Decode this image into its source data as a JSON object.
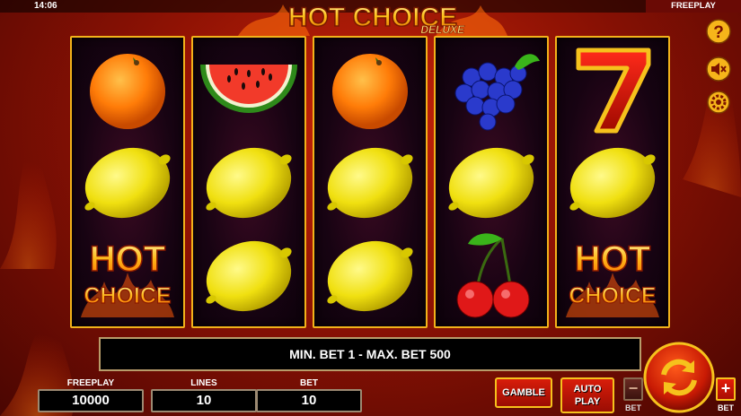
{
  "status_bar": {
    "time": "14:06",
    "mode": "FREEPLAY"
  },
  "game": {
    "title_main": "HOT CHOICE",
    "title_sub": "DELUXE"
  },
  "reels": [
    {
      "symbols": [
        "orange",
        "lemon",
        "hot-choice"
      ]
    },
    {
      "symbols": [
        "watermelon",
        "lemon",
        "lemon"
      ]
    },
    {
      "symbols": [
        "orange",
        "lemon",
        "lemon"
      ]
    },
    {
      "symbols": [
        "grapes",
        "lemon",
        "cherries"
      ]
    },
    {
      "symbols": [
        "seven",
        "lemon",
        "hot-choice"
      ]
    }
  ],
  "scatter_text": {
    "line1": "HOT",
    "line2": "CHOICE"
  },
  "message": "MIN. BET 1 - MAX. BET 500",
  "info": {
    "freeplay_label": "FREEPLAY",
    "freeplay_value": "10000",
    "lines_label": "LINES",
    "lines_value": "10",
    "bet_label": "BET",
    "bet_value": "10"
  },
  "buttons": {
    "gamble": "GAMBLE",
    "auto_line1": "AUTO",
    "auto_line2": "PLAY",
    "bet_minus": "−",
    "bet_minus_label": "BET",
    "bet_plus": "+",
    "bet_plus_label": "BET"
  },
  "side_icons": [
    "help-icon",
    "sound-off-icon",
    "settings-icon"
  ],
  "colors": {
    "frame_gold": "#f2b21a",
    "button_red": "#d81d0a",
    "background_red": "#8e1204",
    "reel_bg": "#170312"
  }
}
